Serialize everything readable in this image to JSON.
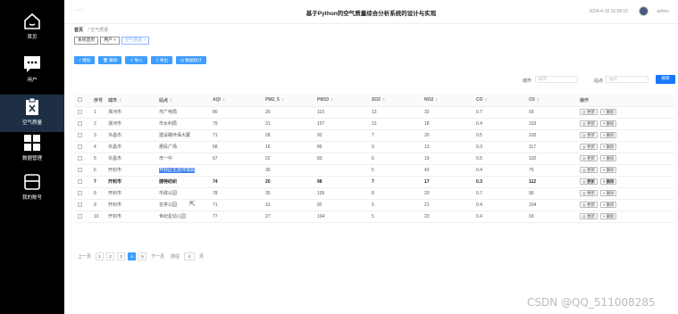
{
  "topbar": {
    "dots": "···",
    "title": "基于Python的空气质量综合分析系统的设计与实现",
    "datetime": "2024-4-18 16:58:15",
    "user": "admin"
  },
  "sidebar": {
    "items": [
      {
        "label": "首页",
        "icon": "home-icon"
      },
      {
        "label": "用户",
        "icon": "chat-icon"
      },
      {
        "label": "空气质量",
        "icon": "clipboard-icon"
      },
      {
        "label": "数据管理",
        "icon": "grid-icon"
      },
      {
        "label": "我的账号",
        "icon": "card-icon"
      }
    ]
  },
  "breadcrumb": {
    "root": "首页",
    "current": "空气质量"
  },
  "tags": [
    "系统首页",
    "用户 ×",
    "空气质量 ×"
  ],
  "toolbar": {
    "add": "+ 增加",
    "delete": "🗑 删除",
    "import": "⇧ 导入",
    "export": "⇩ 导出",
    "stats": "◎ 数据统计"
  },
  "search": {
    "city_label": "城市",
    "city_placeholder": "城市",
    "site_label": "站点",
    "site_placeholder": "站点",
    "button": "搜索"
  },
  "table": {
    "headers": [
      "",
      "序号",
      "城市",
      "站点",
      "AQI",
      "PM2_5",
      "PM10",
      "SO2",
      "NO2",
      "CO",
      "O3",
      "操作"
    ],
    "rows": [
      [
        "1",
        "漯河市",
        "市广电局",
        "80",
        "29",
        "110",
        "13",
        "32",
        "0.7",
        "93"
      ],
      [
        "2",
        "漯河市",
        "市水利局",
        "79",
        "31",
        "107",
        "13",
        "18",
        "0.4",
        "103"
      ],
      [
        "3",
        "许昌市",
        "建设路环保大厦",
        "71",
        "28",
        "92",
        "7",
        "20",
        "0.5",
        "102"
      ],
      [
        "4",
        "许昌市",
        "惠民广场",
        "68",
        "16",
        "86",
        "9",
        "13",
        "0.3",
        "117"
      ],
      [
        "5",
        "许昌市",
        "市一中",
        "67",
        "22",
        "83",
        "6",
        "19",
        "0.5",
        "102"
      ],
      [
        "6",
        "开封市",
        "开封区生态环境局",
        "",
        "30",
        "",
        "5",
        "43",
        "0.4",
        "75"
      ],
      [
        "7",
        "开封市",
        "捷特纺织",
        "74",
        "20",
        "98",
        "7",
        "17",
        "0.3",
        "112"
      ],
      [
        "8",
        "开封市",
        "市政公园",
        "78",
        "35",
        "105",
        "8",
        "20",
        "0.7",
        "96"
      ],
      [
        "9",
        "开封市",
        "龙亭公园",
        "71",
        "31",
        "92",
        "5",
        "21",
        "0.4",
        "104"
      ],
      [
        "10",
        "开封市",
        "世纪星幼儿园",
        "77",
        "27",
        "104",
        "5",
        "23",
        "0.4",
        "93"
      ]
    ],
    "edit": "◎ 更新",
    "del": "× 删除"
  },
  "pager": {
    "prev": "上一页",
    "pages": [
      "1",
      "2",
      "3",
      "4",
      "5"
    ],
    "active": "4",
    "next": "下一页",
    "goto": "前往",
    "goto_value": "4",
    "unit": "页"
  },
  "watermark": "CSDN @QQ_511008285"
}
